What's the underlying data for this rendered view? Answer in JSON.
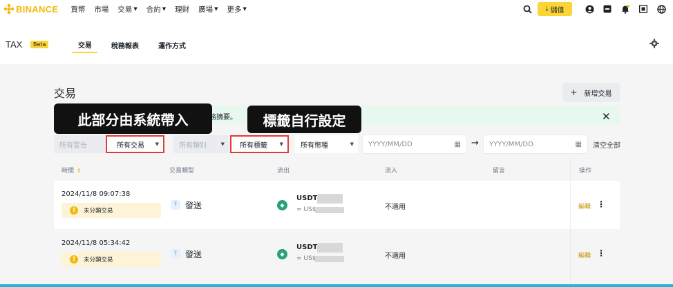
{
  "topbar": {
    "brand": "BINANCE",
    "nav": [
      {
        "label": "買幣",
        "caret": false
      },
      {
        "label": "市場",
        "caret": false
      },
      {
        "label": "交易",
        "caret": true
      },
      {
        "label": "合約",
        "caret": true
      },
      {
        "label": "理財",
        "caret": false
      },
      {
        "label": "廣場",
        "caret": true
      },
      {
        "label": "更多",
        "caret": true
      }
    ],
    "deposit_label": "儲值"
  },
  "subnav": {
    "title": "TAX",
    "beta": "Beta",
    "tabs": [
      "交易",
      "稅務報表",
      "運作方式"
    ]
  },
  "page": {
    "title": "交易",
    "add_button": "新增交易",
    "notice_text": "務摘要。"
  },
  "callouts": {
    "system": "此部分由系統帶入",
    "tags": "標籤自行設定"
  },
  "filters": {
    "warning": "所有警告",
    "transactions": "所有交易",
    "category": "所有類別",
    "tags": "所有標籤",
    "currency": "所有幣種",
    "date_start": "YYYY/MM/DD",
    "date_end": "YYYY/MM/DD",
    "clear_all": "清空全部"
  },
  "table": {
    "headers": {
      "time": "時間",
      "type": "交易類型",
      "outflow": "流出",
      "inflow": "流入",
      "note": "留言",
      "action": "操作"
    },
    "rows": [
      {
        "time": "2024/11/8 09:07:38",
        "badge": "未分類交易",
        "type": "發送",
        "asset": "USDT",
        "usd_prefix": "≈ US$",
        "inflow": "不適用",
        "edit": "編輯"
      },
      {
        "time": "2024/11/8 05:34:42",
        "badge": "未分類交易",
        "type": "發送",
        "asset": "USDT",
        "usd_prefix": "≈ US$",
        "inflow": "不適用",
        "edit": "編輯"
      }
    ]
  },
  "colors": {
    "brand": "#f0b90b",
    "accent_yellow": "#fcd535",
    "notice_bg": "#e7f8ef",
    "callout_bg": "#111111",
    "highlight_red": "#e53935",
    "tether_green": "#26a17b"
  }
}
